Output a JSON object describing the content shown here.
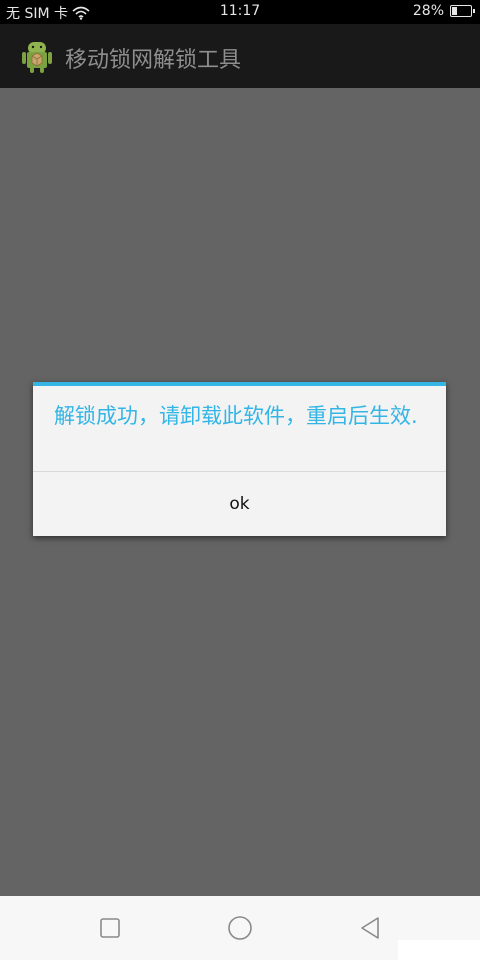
{
  "status_bar": {
    "carrier": "无 SIM 卡",
    "time": "11:17",
    "battery": "28%",
    "battery_level": 0.28,
    "icons": [
      "wifi-icon",
      "battery-icon"
    ]
  },
  "app_bar": {
    "title": "移动锁网解锁工具",
    "icon": "android-app-icon"
  },
  "dialog": {
    "message": "解锁成功，请卸载此软件，重启后生效.",
    "ok_label": "ok",
    "accent_color": "#33b5e5"
  },
  "nav_bar": {
    "icons": [
      "recent-apps-icon",
      "home-icon",
      "back-icon"
    ]
  },
  "colors": {
    "background": "#646464",
    "status_bar": "#000000",
    "action_bar": "#191919",
    "dialog_bg": "#f3f3f3",
    "nav_bar": "#f7f7f7"
  }
}
